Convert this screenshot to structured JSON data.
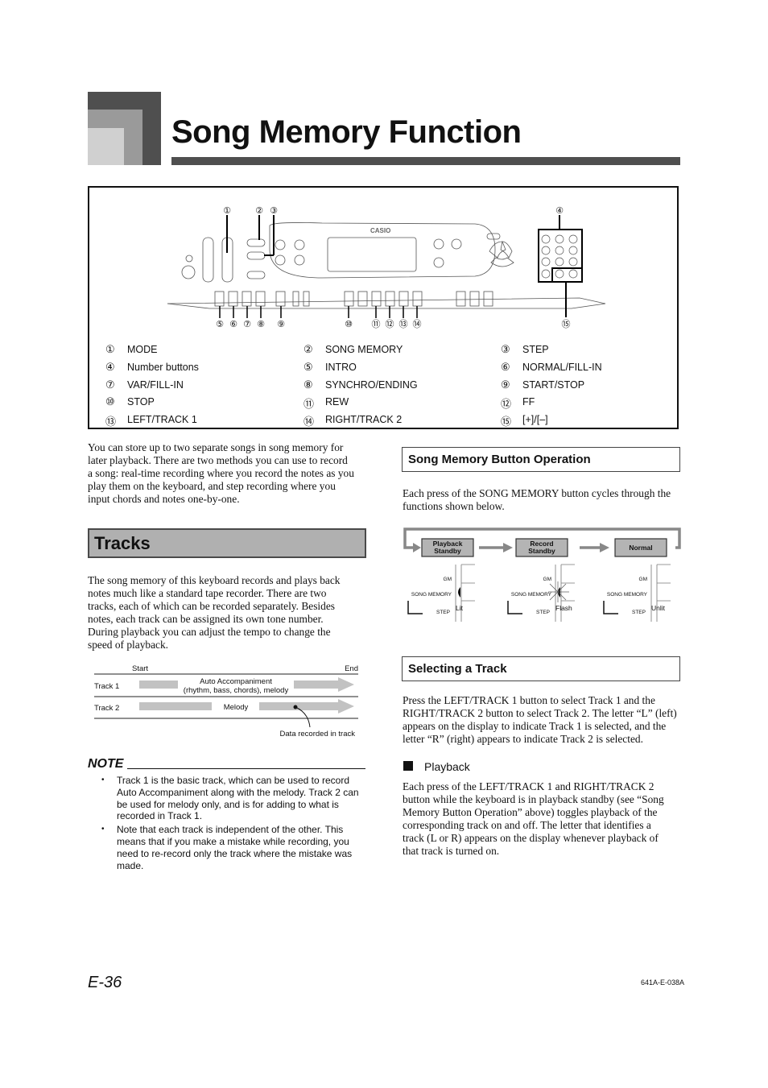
{
  "header": {
    "title": "Song Memory Function"
  },
  "figure": {
    "brand": "CASIO",
    "callouts_top": [
      "①",
      "②",
      "③",
      "④"
    ],
    "callouts_bottom": [
      "⑤",
      "⑥",
      "⑦",
      "⑧",
      "⑨",
      "⑩",
      "⑪",
      "⑫",
      "⑬",
      "⑭",
      "⑮"
    ],
    "legend": [
      {
        "num": "①",
        "label": "MODE"
      },
      {
        "num": "②",
        "label": "SONG MEMORY"
      },
      {
        "num": "③",
        "label": "STEP"
      },
      {
        "num": "④",
        "label": "Number buttons"
      },
      {
        "num": "⑤",
        "label": "INTRO"
      },
      {
        "num": "⑥",
        "label": "NORMAL/FILL-IN"
      },
      {
        "num": "⑦",
        "label": "VAR/FILL-IN"
      },
      {
        "num": "⑧",
        "label": "SYNCHRO/ENDING"
      },
      {
        "num": "⑨",
        "label": "START/STOP"
      },
      {
        "num": "⑩",
        "label": "STOP"
      },
      {
        "num": "⑪",
        "label": "REW"
      },
      {
        "num": "⑫",
        "label": "FF"
      },
      {
        "num": "⑬",
        "label": "LEFT/TRACK 1"
      },
      {
        "num": "⑭",
        "label": "RIGHT/TRACK 2"
      },
      {
        "num": "⑮",
        "label": "[+]/[–]"
      }
    ]
  },
  "intro": {
    "lines": [
      "You can store up to two separate songs in song memory for",
      "later playback. There are two methods you can use to record",
      "a song: real-time recording where you record the notes as you",
      "play them on the keyboard, and step recording where you",
      "input chords and notes one-by-one."
    ]
  },
  "tracks": {
    "heading": "Tracks",
    "lines": [
      "The song memory of this keyboard records and plays back",
      "notes much like a standard tape recorder. There are two",
      "tracks, each of which can be recorded separately. Besides",
      "notes, each track can be assigned its own tone number.",
      "During playback you can adjust the tempo to change the",
      "speed of playback."
    ],
    "diagram": {
      "start": "Start",
      "end": "End",
      "track1": "Track 1",
      "track1_content_line1": "Auto Accompaniment",
      "track1_content_line2": "(rhythm, bass, chords), melody",
      "track2": "Track 2",
      "track2_content": "Melody",
      "annotation": "Data recorded in track"
    }
  },
  "note": {
    "title": "NOTE",
    "items": [
      "Track 1 is the basic track, which can be used to record Auto Accompaniment along with the melody. Track 2 can be used for melody only, and is for adding to what is recorded in Track 1.",
      "Note that each track is independent of the other. This means that if you make a mistake while recording, you need to re-record only the track where the mistake was made."
    ]
  },
  "song_memory_op": {
    "heading": "Song Memory Button Operation",
    "lines": [
      "Each press of the SONG MEMORY button cycles through the",
      "functions shown below."
    ],
    "states": [
      {
        "line1": "Playback",
        "line2": "Standby",
        "indicator": "Lit"
      },
      {
        "line1": "Record",
        "line2": "Standby",
        "indicator": "Flash"
      },
      {
        "line1": "Normal",
        "line2": "",
        "indicator": "Unlit"
      }
    ],
    "display_labels": {
      "gm": "GM",
      "song_memory": "SONG MEMORY",
      "step": "STEP"
    }
  },
  "selecting_track": {
    "heading": "Selecting a Track",
    "lines": [
      "Press the LEFT/TRACK 1 button to select Track 1 and the",
      "RIGHT/TRACK 2 button to select Track 2. The letter “L” (left)",
      "appears on the display to indicate Track 1 is selected, and the",
      "letter “R” (right) appears to indicate Track 2 is selected."
    ]
  },
  "playback": {
    "heading": "Playback",
    "lines": [
      "Each press of the LEFT/TRACK 1 and RIGHT/TRACK 2",
      "button while the keyboard is in playback standby (see “Song",
      "Memory Button Operation” above) toggles playback of the",
      "corresponding track on and off. The letter that identifies a",
      "track (L or R) appears on the display whenever playback of",
      "that track is turned on."
    ]
  },
  "footer": {
    "page": "E-36",
    "code": "641A-E-038A"
  }
}
